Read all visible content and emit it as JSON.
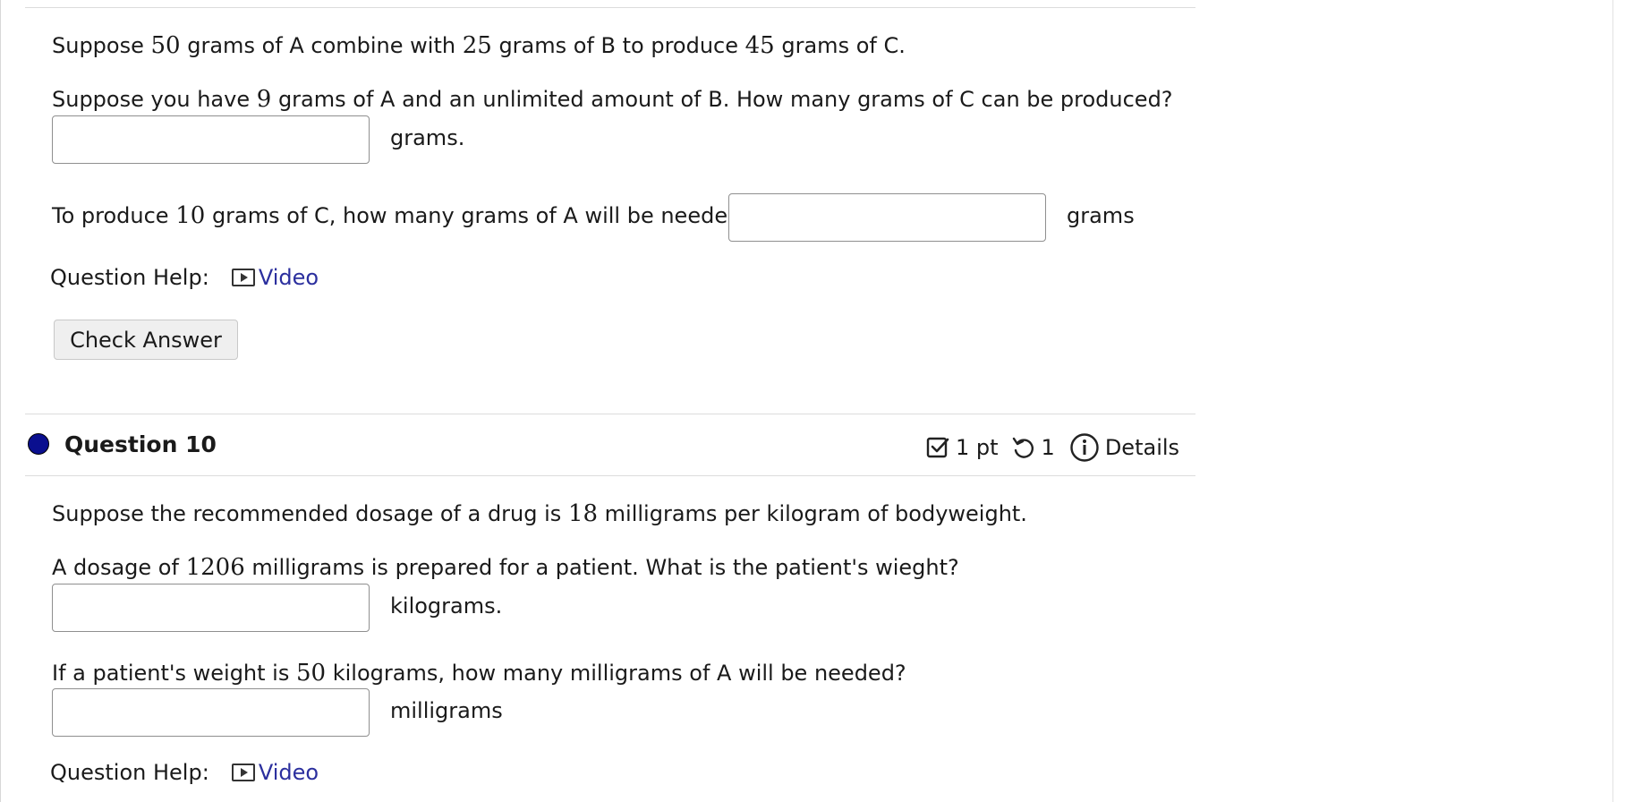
{
  "q9": {
    "line1": {
      "a": "Suppose",
      "n1": "50",
      "b": "grams of A combine with",
      "n2": "25",
      "c": "grams of B to produce",
      "n3": "45",
      "d": "grams of C."
    },
    "line2": {
      "a": "Suppose you have",
      "n1": "9",
      "b": "grams of A and an unlimited amount of B. How many grams of C can be produced?"
    },
    "answer1_unit": "grams.",
    "line3": {
      "a": "To produce",
      "n1": "10",
      "b": "grams of C, how many grams of A will be needed?"
    },
    "answer2_unit": "grams",
    "help_label": "Question Help:",
    "video_label": "Video",
    "check_label": "Check Answer"
  },
  "q10": {
    "title": "Question 10",
    "points": "1 pt",
    "attempts": "1",
    "details_label": "Details",
    "line1": {
      "a": "Suppose the recommended dosage of a drug is",
      "n1": "18",
      "b": "milligrams per kilogram of bodyweight."
    },
    "line2": {
      "a": "A dosage of",
      "n1": "1206",
      "b": "milligrams is prepared for a patient. What is the patient's wieght?"
    },
    "answer1_unit": "kilograms.",
    "line3": {
      "a": "If a patient's weight is",
      "n1": "50",
      "b": "kilograms, how many milligrams of A will be needed?"
    },
    "answer2_unit": "milligrams",
    "help_label": "Question Help:",
    "video_label": "Video"
  },
  "colors": {
    "link": "#2b2f9e",
    "question_dot": "#0a0f8f",
    "button_bg": "#efefef"
  },
  "icons": [
    "video-icon",
    "checkbox-icon",
    "retry-icon",
    "info-icon",
    "question-status-dot-icon"
  ]
}
